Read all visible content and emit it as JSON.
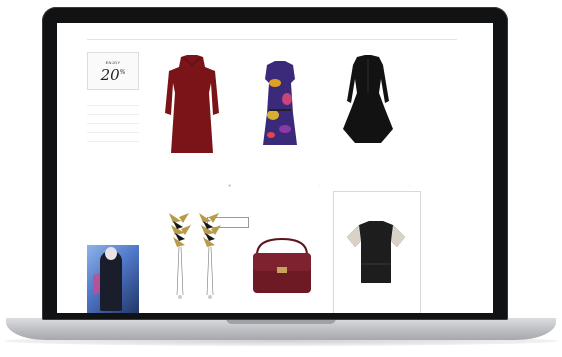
{
  "promo": {
    "small_text": "ENJOY",
    "big_text": "20",
    "suffix": "%"
  },
  "sidebar": {
    "heading": "",
    "items": [
      "",
      "",
      "",
      "",
      ""
    ],
    "sub_items": [
      "",
      ""
    ],
    "plain_items": [
      "",
      "",
      "",
      "",
      ""
    ]
  },
  "top_nav": [
    "",
    "",
    "",
    "",
    "",
    "",
    "",
    "",
    "",
    "",
    "",
    "",
    ""
  ],
  "products": [
    {
      "brand": "",
      "desc": "",
      "price": "",
      "sale": ""
    },
    {
      "brand": "",
      "desc": "",
      "price": "",
      "sale": ""
    },
    {
      "brand": "",
      "desc": "",
      "price": "",
      "sale": ""
    }
  ],
  "quick_view": "",
  "colors": {
    "red_dress": "#7a1418",
    "black_dress": "#121212",
    "bag": "#6e1a24",
    "sale": "#c0392b"
  }
}
